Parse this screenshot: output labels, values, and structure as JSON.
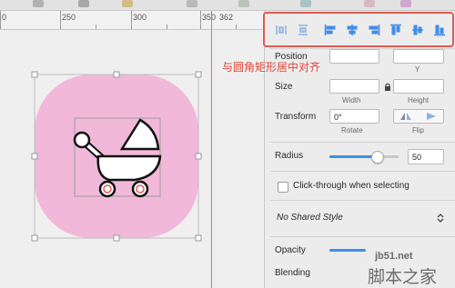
{
  "ruler": {
    "ticks": [
      "0",
      "250",
      "300",
      "350",
      "362"
    ]
  },
  "annotation": "与圆角矩形居中对齐",
  "inspector": {
    "position_label": "Position",
    "y_label": "Y",
    "size_label": "Size",
    "width_label": "Width",
    "height_label": "Height",
    "transform_label": "Transform",
    "rotate_value": "0°",
    "rotate_label": "Rotate",
    "flip_label": "Flip",
    "radius_label": "Radius",
    "radius_value": "50",
    "radius_slider_fraction": 0.68,
    "clickthrough_label": "Click-through when selecting",
    "shared_style": "No Shared Style",
    "opacity_label": "Opacity",
    "blending_label": "Blending"
  },
  "watermark": {
    "site": "jb51.net",
    "text": "脚本之家"
  },
  "colors": {
    "shape_fill": "#f1b8d9",
    "accent_red": "#e05a52",
    "slider_blue": "#3f8de9"
  },
  "icons": [
    "distribute-horizontal-icon",
    "distribute-vertical-icon",
    "align-left-icon",
    "align-center-horizontal-icon",
    "align-right-icon",
    "align-top-icon",
    "align-middle-vertical-icon",
    "align-bottom-icon",
    "baby-stroller-icon",
    "lock-icon",
    "flip-horizontal-icon",
    "flip-vertical-icon",
    "chevron-updown-icon"
  ]
}
